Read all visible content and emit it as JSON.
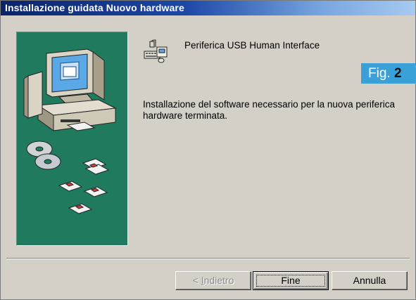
{
  "window": {
    "title": "Installazione guidata Nuovo hardware"
  },
  "device": {
    "name": "Periferica USB Human Interface",
    "icon": "usb-keyboard-mouse-icon"
  },
  "message": "Installazione del software necessario per la nuova periferica hardware terminata.",
  "badge": {
    "prefix": "Fig.",
    "number": "2"
  },
  "buttons": {
    "back": {
      "prefix": "< ",
      "accel": "I",
      "rest": "ndietro",
      "enabled": false
    },
    "finish": {
      "label": "Fine",
      "default": true
    },
    "cancel": {
      "label": "Annulla"
    }
  },
  "colors": {
    "panel": "#1f7a5e",
    "title_start": "#0a246a",
    "title_end": "#a6caf0",
    "badge": "#3aa0d8"
  }
}
